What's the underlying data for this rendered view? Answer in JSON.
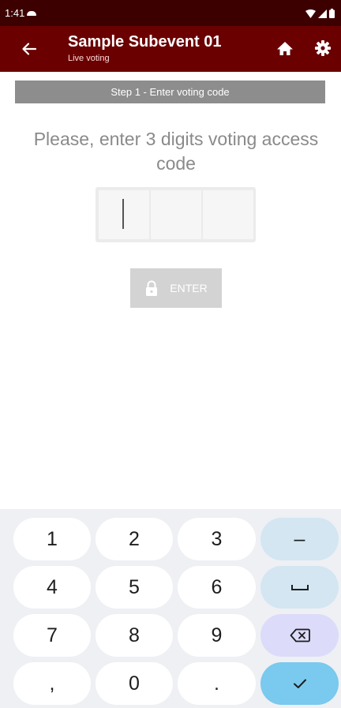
{
  "status_bar": {
    "time": "1:41",
    "icons": [
      "cloud-icon",
      "wifi-icon",
      "signal-icon",
      "battery-icon"
    ]
  },
  "app_bar": {
    "title": "Sample Subevent 01",
    "subtitle": "Live voting",
    "icons": [
      "back-arrow-icon",
      "home-icon",
      "gear-icon"
    ],
    "color": "#6a0000"
  },
  "step": {
    "label": "Step 1 - Enter voting code"
  },
  "instruction": "Please, enter 3 digits voting access code",
  "code_input": {
    "digits": [
      "",
      "",
      ""
    ]
  },
  "enter_button": {
    "label": "ENTER",
    "icon": "lock-icon",
    "enabled": false
  },
  "keyboard": {
    "rows": [
      [
        "1",
        "2",
        "3",
        "–"
      ],
      [
        "4",
        "5",
        "6",
        "space"
      ],
      [
        "7",
        "8",
        "9",
        "backspace"
      ],
      [
        ",",
        "0",
        ".",
        "done"
      ]
    ],
    "labels": {
      "k1": "1",
      "k2": "2",
      "k3": "3",
      "k4": "4",
      "k5": "5",
      "k6": "6",
      "k7": "7",
      "k8": "8",
      "k9": "9",
      "comma": ",",
      "k0": "0",
      "period": ".",
      "minus": "–"
    }
  }
}
